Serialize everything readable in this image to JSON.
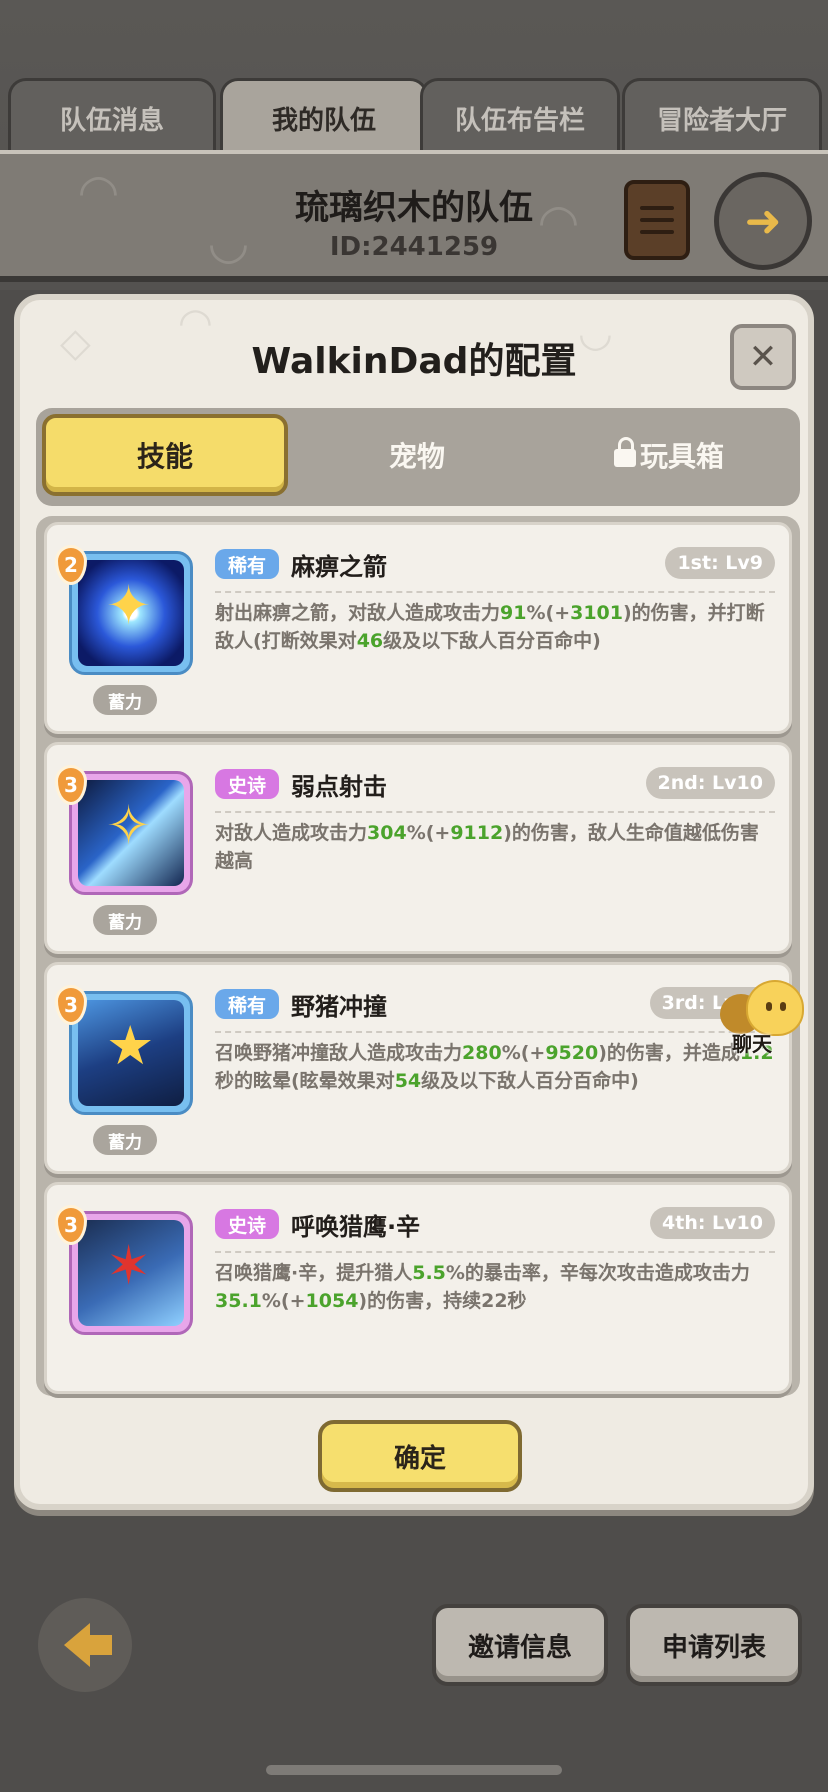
{
  "tabs": [
    {
      "label": "队伍消息"
    },
    {
      "label": "我的队伍"
    },
    {
      "label": "队伍布告栏"
    },
    {
      "label": "冒险者大厅"
    }
  ],
  "team": {
    "name": "琉璃织木的队伍",
    "id": "ID:2441259"
  },
  "modal": {
    "title": "WalkinDad的配置",
    "close_label": "✕",
    "segments": [
      {
        "label": "技能",
        "active": true
      },
      {
        "label": "宠物",
        "active": false
      },
      {
        "label": "玩具箱",
        "active": false,
        "locked": true
      }
    ],
    "skills": [
      {
        "badge": "2",
        "rarity": "稀有",
        "rarity_type": "rare",
        "name": "麻痹之箭",
        "level": "1st: Lv9",
        "tag": "蓄力",
        "desc": [
          {
            "t": "射出麻痹之箭，对敌人造成攻击力"
          },
          {
            "t": "91",
            "g": true
          },
          {
            "t": "%(+"
          },
          {
            "t": "3101",
            "g": true
          },
          {
            "t": ")的伤害，并打断敌人(打断效果对"
          },
          {
            "t": "46",
            "g": true
          },
          {
            "t": "级及以下敌人百分百命中)"
          }
        ]
      },
      {
        "badge": "3",
        "rarity": "史诗",
        "rarity_type": "epic",
        "name": "弱点射击",
        "level": "2nd: Lv10",
        "tag": "蓄力",
        "desc": [
          {
            "t": "对敌人造成攻击力"
          },
          {
            "t": "304",
            "g": true
          },
          {
            "t": "%(+"
          },
          {
            "t": "9112",
            "g": true
          },
          {
            "t": ")的伤害，敌人生命值越低伤害越高"
          }
        ]
      },
      {
        "badge": "3",
        "rarity": "稀有",
        "rarity_type": "rare",
        "name": "野猪冲撞",
        "level": "3rd: Lv10",
        "tag": "蓄力",
        "desc": [
          {
            "t": "召唤野猪冲撞敌人造成攻击力"
          },
          {
            "t": "280",
            "g": true
          },
          {
            "t": "%(+"
          },
          {
            "t": "9520",
            "g": true
          },
          {
            "t": ")的伤害，并造成"
          },
          {
            "t": "1.2",
            "g": true
          },
          {
            "t": "秒的眩晕(眩晕效果对"
          },
          {
            "t": "54",
            "g": true
          },
          {
            "t": "级及以下敌人百分百命中)"
          }
        ]
      },
      {
        "badge": "3",
        "rarity": "史诗",
        "rarity_type": "epic",
        "name": "呼唤猎鹰·辛",
        "level": "4th: Lv10",
        "tag": "",
        "desc": [
          {
            "t": "召唤猎鹰·辛，提升猎人"
          },
          {
            "t": "5.5",
            "g": true
          },
          {
            "t": "%的暴击率，辛每次攻击造成攻击力"
          },
          {
            "t": "35.1",
            "g": true
          },
          {
            "t": "%(+"
          },
          {
            "t": "1054",
            "g": true
          },
          {
            "t": ")的伤害，持续22秒"
          }
        ]
      }
    ],
    "confirm_label": "确定"
  },
  "chat": {
    "label": "聊天"
  },
  "bottom": {
    "invite_label": "邀请信息",
    "apply_label": "申请列表"
  }
}
